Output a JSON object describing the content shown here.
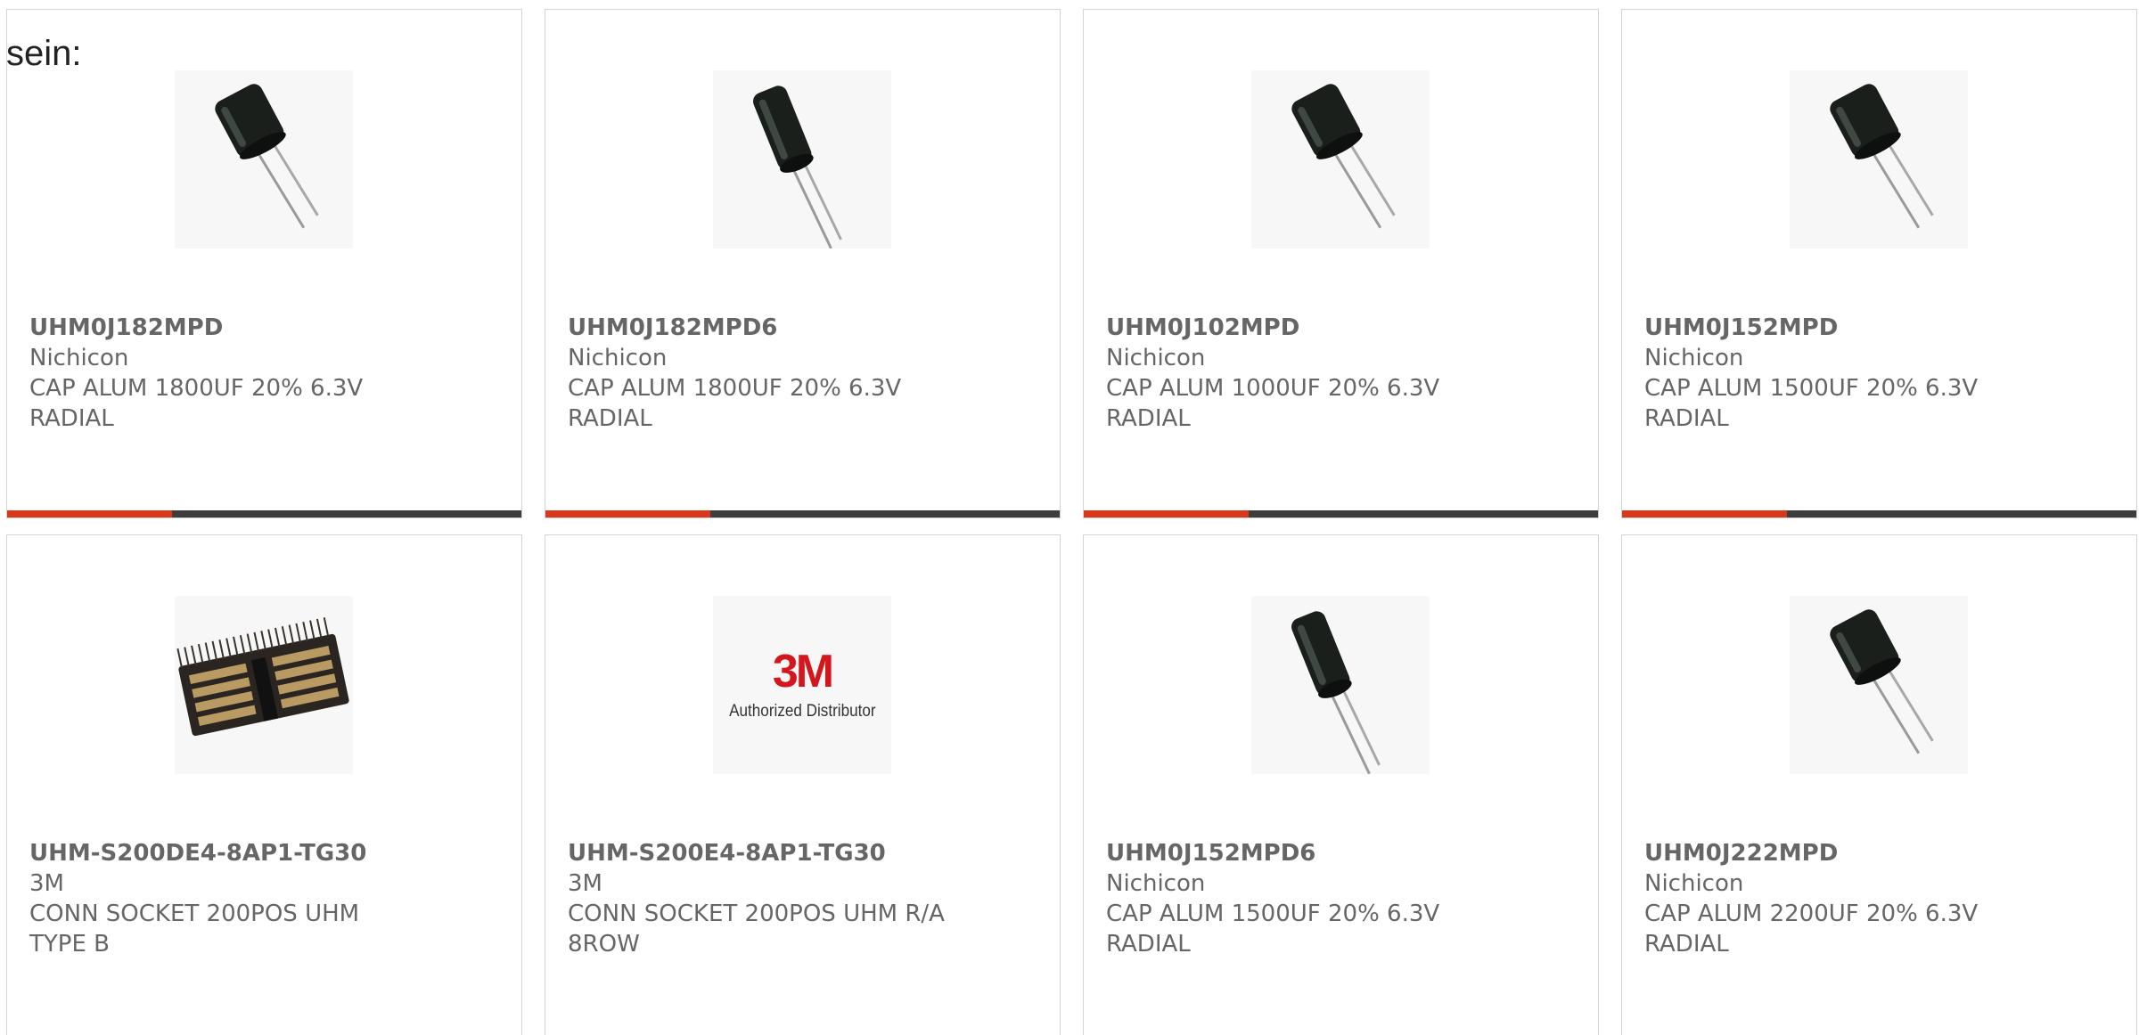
{
  "intro_text": "sein:",
  "colors": {
    "accent": "#d8391b",
    "bar": "#3d3d3d",
    "text": "#666666",
    "border": "#d4d4d4"
  },
  "products": [
    {
      "part_number": "UHM0J182MPD",
      "manufacturer": "Nichicon",
      "description": "CAP ALUM 1800UF 20% 6.3V\nRADIAL",
      "image": "capacitor-short",
      "progress": 0.32
    },
    {
      "part_number": "UHM0J182MPD6",
      "manufacturer": "Nichicon",
      "description": "CAP ALUM 1800UF 20% 6.3V\nRADIAL",
      "image": "capacitor-tall",
      "progress": 0.32
    },
    {
      "part_number": "UHM0J102MPD",
      "manufacturer": "Nichicon",
      "description": "CAP ALUM 1000UF 20% 6.3V\nRADIAL",
      "image": "capacitor-short",
      "progress": 0.32
    },
    {
      "part_number": "UHM0J152MPD",
      "manufacturer": "Nichicon",
      "description": "CAP ALUM 1500UF 20% 6.3V\nRADIAL",
      "image": "capacitor-short",
      "progress": 0.32
    },
    {
      "part_number": "UHM-S200DE4-8AP1-TG30",
      "manufacturer": "3M",
      "description": "CONN SOCKET 200POS UHM\nTYPE B",
      "image": "connector",
      "progress": null
    },
    {
      "part_number": "UHM-S200E4-8AP1-TG30",
      "manufacturer": "3M",
      "description": "CONN SOCKET 200POS UHM R/A\n8ROW",
      "image": "3m-logo",
      "logo_mark": "3M",
      "logo_sub": "Authorized Distributor",
      "progress": null
    },
    {
      "part_number": "UHM0J152MPD6",
      "manufacturer": "Nichicon",
      "description": "CAP ALUM 1500UF 20% 6.3V\nRADIAL",
      "image": "capacitor-tall",
      "progress": null
    },
    {
      "part_number": "UHM0J222MPD",
      "manufacturer": "Nichicon",
      "description": "CAP ALUM 2200UF 20% 6.3V\nRADIAL",
      "image": "capacitor-short",
      "progress": null
    }
  ]
}
